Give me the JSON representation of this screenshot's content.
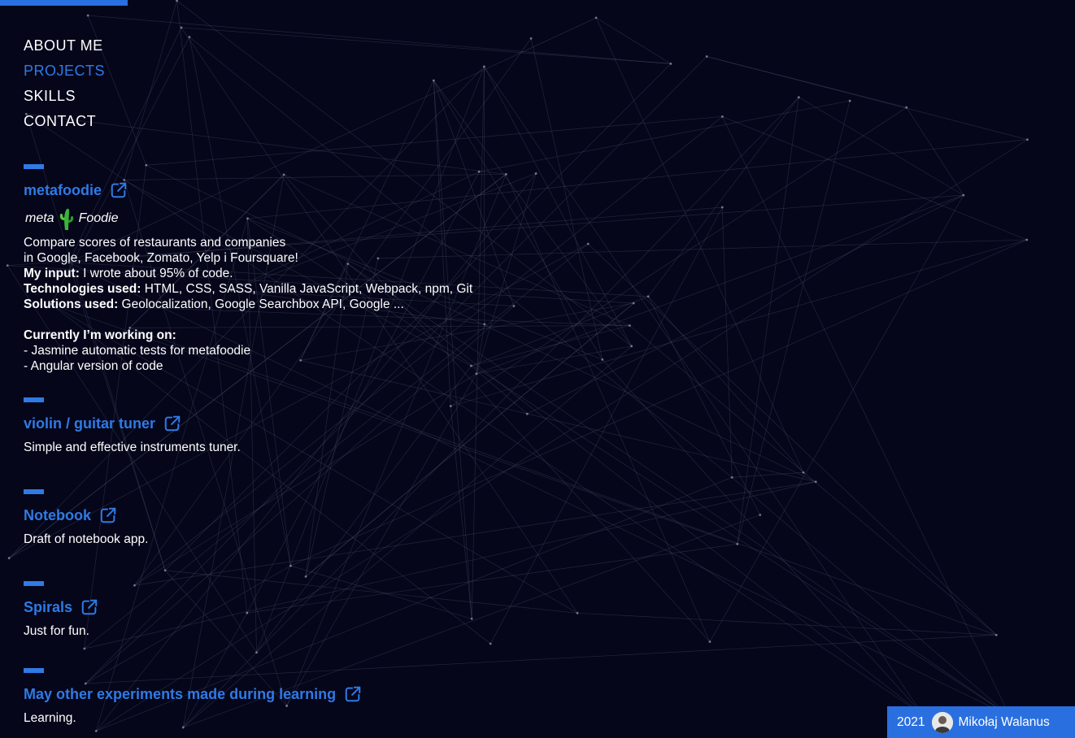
{
  "nav": {
    "items": [
      {
        "label": "ABOUT ME"
      },
      {
        "label": "PROJECTS"
      },
      {
        "label": "SKILLS"
      },
      {
        "label": "CONTACT"
      }
    ],
    "active": "PROJECTS"
  },
  "projects": [
    {
      "title": "metafoodie",
      "logo": {
        "left": "meta",
        "right": "Foodie"
      },
      "lines": [
        "Compare scores of restaurants and companies",
        "in Google, Facebook, Zomato, Yelp i Foursquare!"
      ],
      "input_label": "My input:",
      "input_value": " I wrote about 95% of code.",
      "tech_label": "Technologies used:",
      "tech_value": " HTML, CSS, SASS, Vanilla JavaScript, Webpack, npm, Git",
      "solutions_label": "Solutions used:",
      "solutions_value": " Geolocalization, Google Searchbox API,  Google ...",
      "working_label": "Currently I’m working on:",
      "working_items": [
        "- Jasmine automatic tests for metafoodie",
        "- Angular version of code"
      ]
    },
    {
      "title": "violin / guitar tuner",
      "description": "Simple and effective instruments tuner."
    },
    {
      "title": "Notebook",
      "description": "Draft of notebook app."
    },
    {
      "title": "Spirals",
      "description": "Just for fun."
    },
    {
      "title": "May other experiments made during learning",
      "description": "Learning."
    }
  ],
  "footer": {
    "year": "2021",
    "name": "Mikołaj Walanus"
  },
  "colors": {
    "accent": "#2f7ae5",
    "background": "#05061a",
    "footer_bg": "#2a6fe0"
  },
  "icons": {
    "external_link": "external-link-icon",
    "logo_cactus": "cactus-icon"
  }
}
